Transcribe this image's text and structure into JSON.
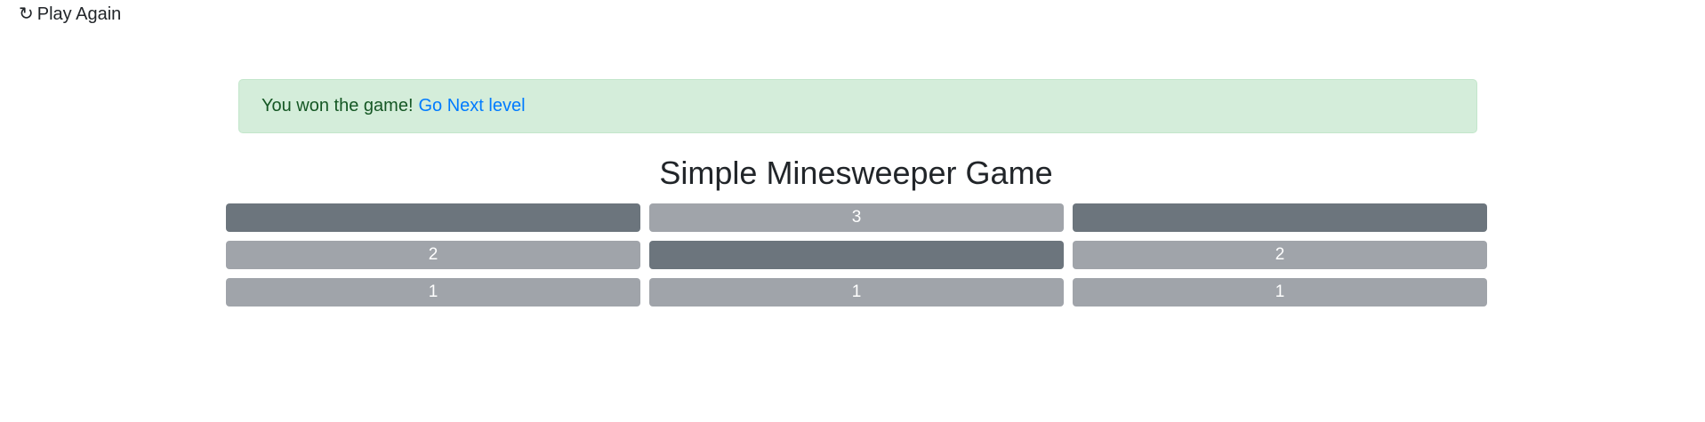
{
  "header": {
    "play_again_icon": "↻",
    "play_again_label": "Play Again"
  },
  "alert": {
    "message": "You won the game!",
    "link_label": "Go Next level"
  },
  "title": "Simple Minesweeper Game",
  "colors": {
    "closed_cell": "#6c757d",
    "open_cell": "#a0a4aa",
    "alert_bg": "#d4edda",
    "alert_text": "#155724",
    "link": "#007bff"
  },
  "board": {
    "rows": [
      [
        {
          "state": "closed",
          "label": ""
        },
        {
          "state": "open",
          "label": "3"
        },
        {
          "state": "closed",
          "label": ""
        }
      ],
      [
        {
          "state": "open",
          "label": "2"
        },
        {
          "state": "closed",
          "label": ""
        },
        {
          "state": "open",
          "label": "2"
        }
      ],
      [
        {
          "state": "open",
          "label": "1"
        },
        {
          "state": "open",
          "label": "1"
        },
        {
          "state": "open",
          "label": "1"
        }
      ]
    ]
  }
}
